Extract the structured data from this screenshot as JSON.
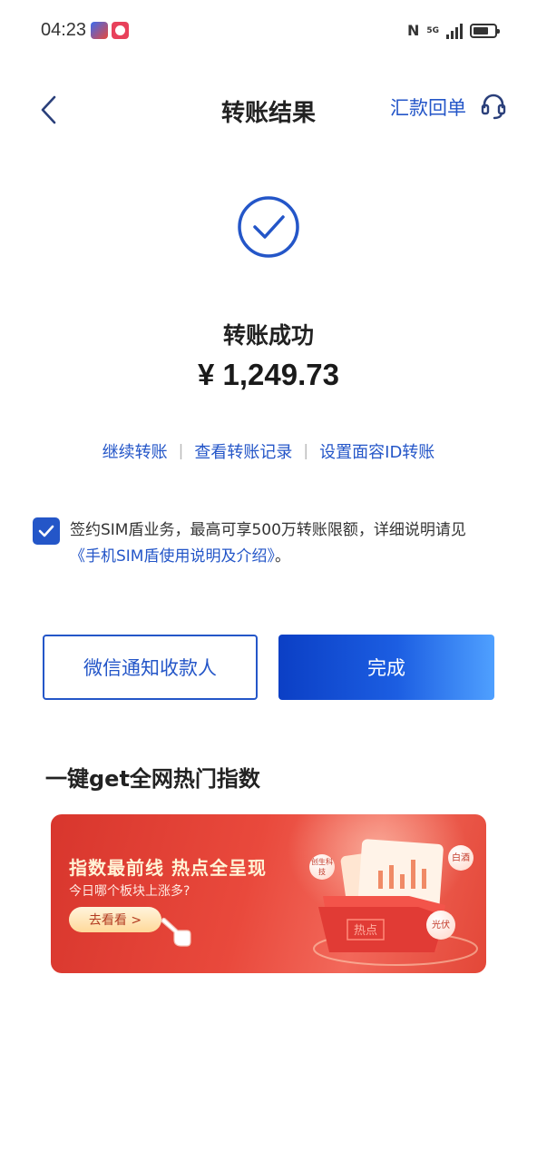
{
  "status_bar": {
    "time": "04:23",
    "network": "5G"
  },
  "header": {
    "title": "转账结果",
    "receipt_label": "汇款回单"
  },
  "result": {
    "status_text": "转账成功",
    "amount": "¥ 1,249.73"
  },
  "actions": {
    "continue": "继续转账",
    "history": "查看转账记录",
    "faceid": "设置面容ID转账"
  },
  "agreement": {
    "checked": true,
    "text_prefix": "签约SIM盾业务，最高可享500万转账限额，详细说明请见",
    "link": "《手机SIM盾使用说明及介绍》",
    "text_suffix": "。"
  },
  "buttons": {
    "notify": "微信通知收款人",
    "done": "完成"
  },
  "section": {
    "title": "一键get全网热门指数"
  },
  "banner": {
    "headline": "指数最前线  热点全呈现",
    "subtitle": "今日哪个板块上涨多?",
    "cta": "去看看 >",
    "tags": [
      "创生科技",
      "白酒",
      "光伏"
    ],
    "art_text": "热点"
  },
  "colors": {
    "accent": "#2456c8",
    "banner": "#e3443a"
  }
}
